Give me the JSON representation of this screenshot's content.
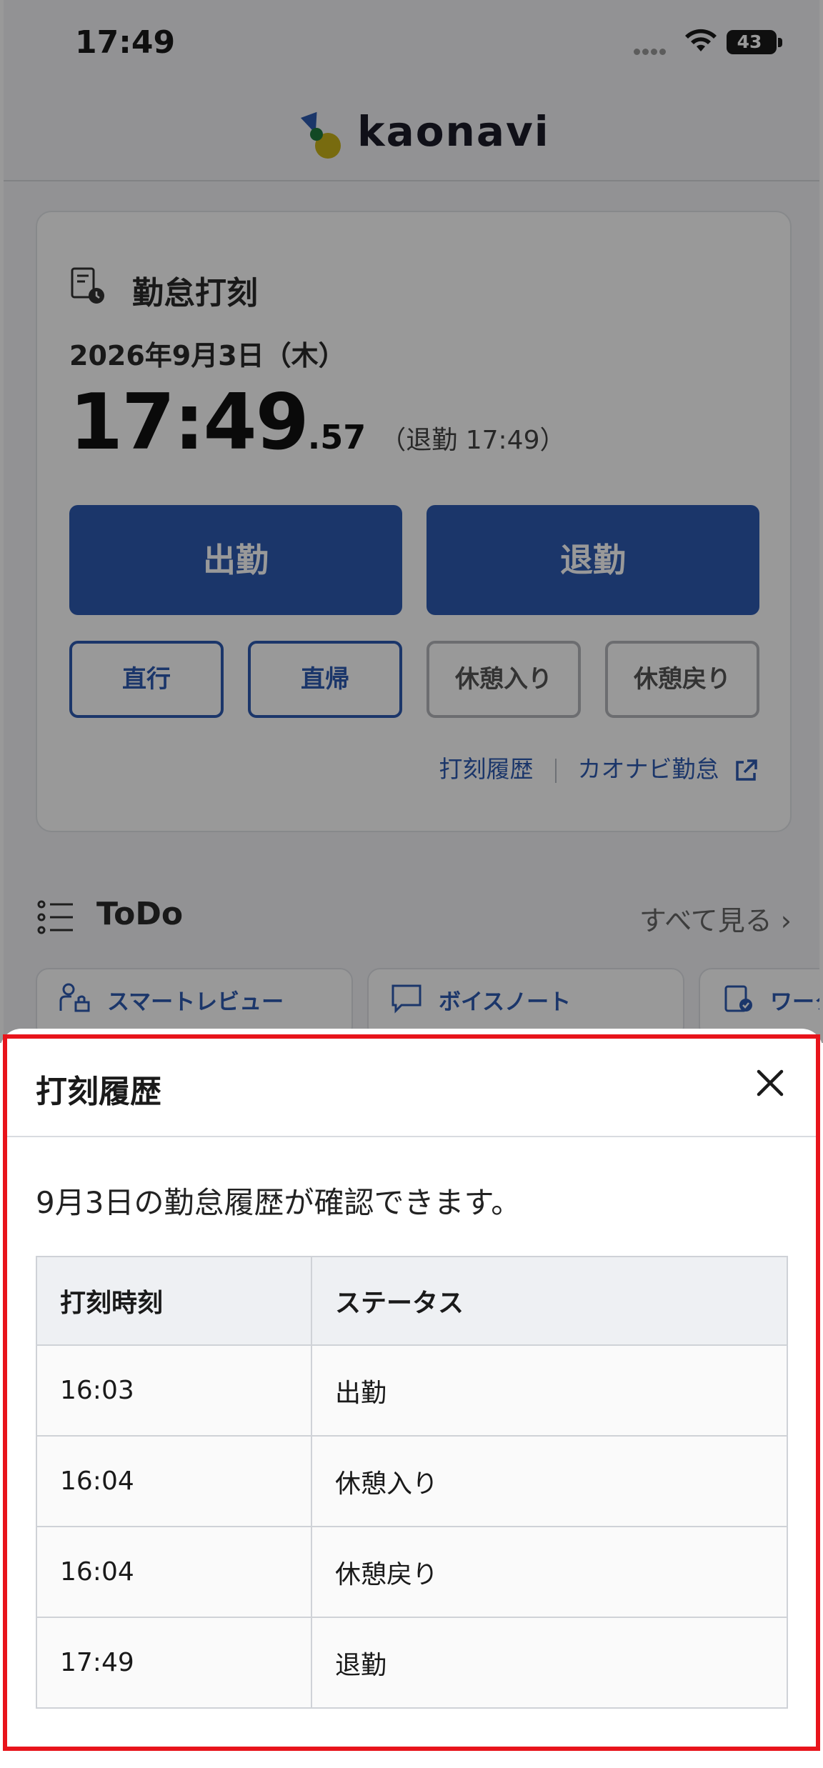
{
  "status_bar": {
    "time": "17:49",
    "battery_level": "43",
    "icons": [
      "signal-dots-icon",
      "wifi-icon",
      "battery-icon"
    ]
  },
  "header": {
    "logo_text": "kaonavi",
    "logo_colors": {
      "blue": "#2d5bb0",
      "yellow": "#c9b21a",
      "green": "#1f7a3c"
    }
  },
  "attendance": {
    "title": "勤怠打刻",
    "date": "2026年9月3日（木）",
    "clock_main": "17:49",
    "clock_seconds": ".57",
    "clock_note": "（退勤 17:49）",
    "clock_in_label": "出勤",
    "clock_out_label": "退勤",
    "direct_go_label": "直行",
    "direct_return_label": "直帰",
    "break_start_label": "休憩入り",
    "break_end_label": "休憩戻り",
    "history_link": "打刻履歴",
    "kaonavi_attendance_link": "カオナビ勤怠",
    "accent_color": "#2e5ab1"
  },
  "todo": {
    "title": "ToDo",
    "see_all": "すべて見る ›",
    "tabs": [
      {
        "label": "スマートレビュー",
        "icon": "review-icon"
      },
      {
        "label": "ボイスノート",
        "icon": "speech-bubble-icon"
      },
      {
        "label": "ワーク",
        "icon": "workflow-icon"
      }
    ]
  },
  "sheet": {
    "title": "打刻履歴",
    "description": "9月3日の勤怠履歴が確認できます。",
    "table": {
      "headers": [
        "打刻時刻",
        "ステータス"
      ],
      "rows": [
        {
          "time": "16:03",
          "status": "出勤"
        },
        {
          "time": "16:04",
          "status": "休憩入り"
        },
        {
          "time": "16:04",
          "status": "休憩戻り"
        },
        {
          "time": "17:49",
          "status": "退勤"
        }
      ]
    },
    "highlight_color": "#e8141b"
  }
}
